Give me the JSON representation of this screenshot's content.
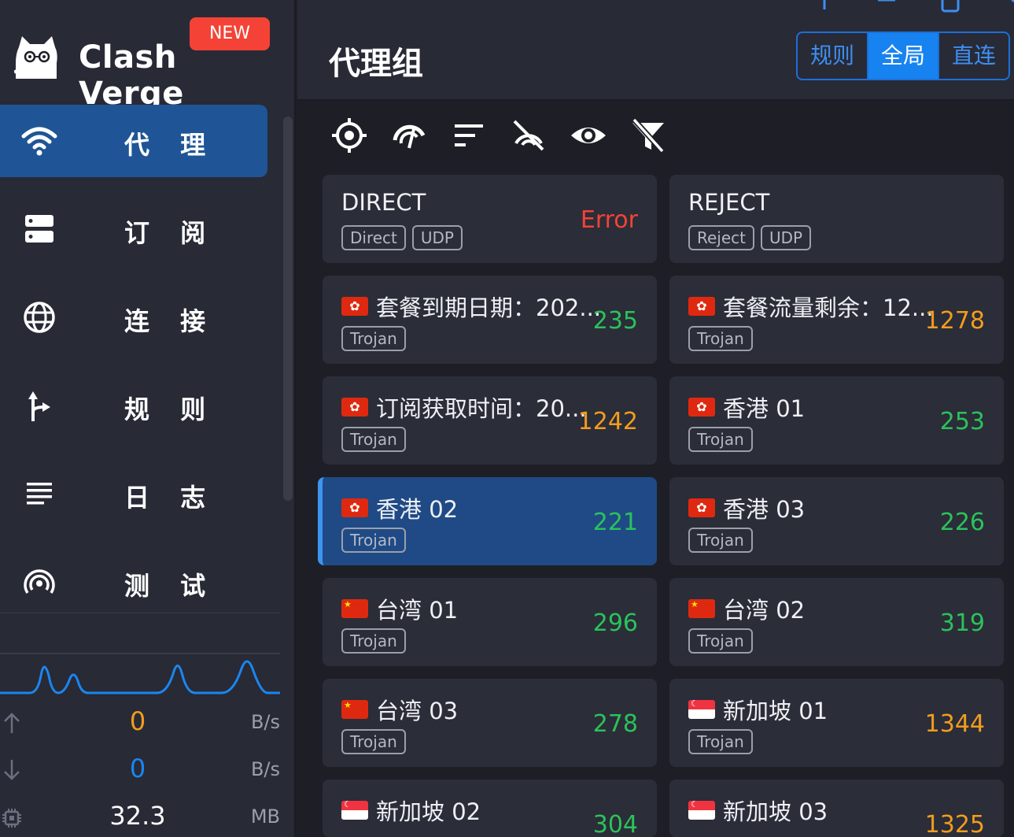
{
  "app": {
    "brand": "Clash Verge",
    "new_badge": "NEW"
  },
  "sidebar": {
    "items": [
      {
        "label": "代 理",
        "icon": "wifi-icon",
        "active": true
      },
      {
        "label": "订 阅",
        "icon": "server-icon",
        "active": false
      },
      {
        "label": "连 接",
        "icon": "globe-icon",
        "active": false
      },
      {
        "label": "规 则",
        "icon": "fork-arrow-icon",
        "active": false
      },
      {
        "label": "日 志",
        "icon": "list-lines-icon",
        "active": false
      },
      {
        "label": "测 试",
        "icon": "radar-icon",
        "active": false
      }
    ],
    "traffic": {
      "upload": {
        "value": "0",
        "unit": "B/s"
      },
      "download": {
        "value": "0",
        "unit": "B/s"
      },
      "memory": {
        "value": "32.3",
        "unit": "MB"
      }
    }
  },
  "header": {
    "title": "代理组",
    "modes": [
      {
        "label": "规则",
        "active": false
      },
      {
        "label": "全局",
        "active": true
      },
      {
        "label": "直连",
        "active": false
      }
    ]
  },
  "toolbar": {
    "icons": [
      "locate-icon",
      "speed-test-icon",
      "sort-icon",
      "disable-test-icon",
      "eye-icon",
      "filter-off-icon"
    ]
  },
  "proxies": [
    {
      "name": "DIRECT",
      "tags": [
        "Direct",
        "UDP"
      ],
      "delay": "Error",
      "delay_color": "#f44336",
      "flag": ""
    },
    {
      "name": "REJECT",
      "tags": [
        "Reject",
        "UDP"
      ],
      "delay": "",
      "delay_color": "",
      "flag": ""
    },
    {
      "name": "套餐到期日期：202...",
      "tags": [
        "Trojan"
      ],
      "delay": "235",
      "delay_color": "#2bc25a",
      "flag": "hk"
    },
    {
      "name": "套餐流量剩余：12...",
      "tags": [
        "Trojan"
      ],
      "delay": "1278",
      "delay_color": "#f39c1d",
      "flag": "hk"
    },
    {
      "name": "订阅获取时间：20...",
      "tags": [
        "Trojan"
      ],
      "delay": "1242",
      "delay_color": "#f39c1d",
      "flag": "hk"
    },
    {
      "name": "香港 01",
      "tags": [
        "Trojan"
      ],
      "delay": "253",
      "delay_color": "#2bc25a",
      "flag": "hk"
    },
    {
      "name": "香港 02",
      "tags": [
        "Trojan"
      ],
      "delay": "221",
      "delay_color": "#2bc25a",
      "flag": "hk",
      "selected": true
    },
    {
      "name": "香港 03",
      "tags": [
        "Trojan"
      ],
      "delay": "226",
      "delay_color": "#2bc25a",
      "flag": "hk"
    },
    {
      "name": "台湾 01",
      "tags": [
        "Trojan"
      ],
      "delay": "296",
      "delay_color": "#2bc25a",
      "flag": "cn"
    },
    {
      "name": "台湾 02",
      "tags": [
        "Trojan"
      ],
      "delay": "319",
      "delay_color": "#2bc25a",
      "flag": "cn"
    },
    {
      "name": "台湾 03",
      "tags": [
        "Trojan"
      ],
      "delay": "278",
      "delay_color": "#2bc25a",
      "flag": "cn"
    },
    {
      "name": "新加坡 01",
      "tags": [
        "Trojan"
      ],
      "delay": "1344",
      "delay_color": "#f39c1d",
      "flag": "sg"
    },
    {
      "name": "新加坡 02",
      "tags": [],
      "delay": "304",
      "delay_color": "#2bc25a",
      "flag": "sg"
    },
    {
      "name": "新加坡 03",
      "tags": [],
      "delay": "1325",
      "delay_color": "#f39c1d",
      "flag": "sg"
    }
  ]
}
